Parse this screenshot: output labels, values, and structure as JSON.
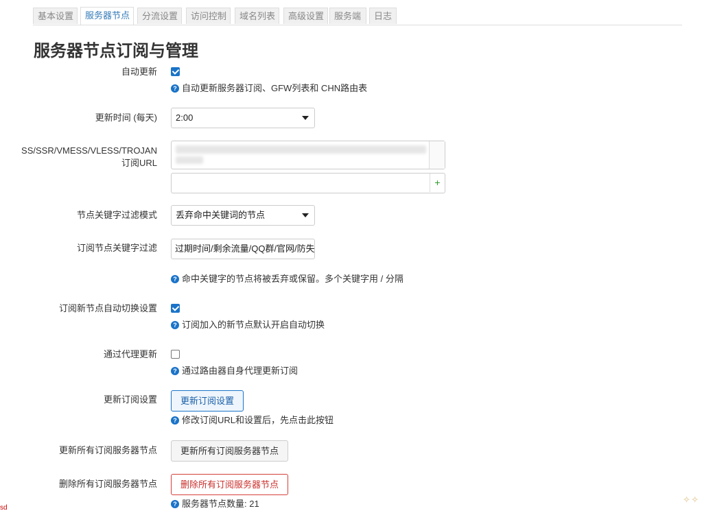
{
  "tabs": [
    {
      "label": "基本设置",
      "active": false
    },
    {
      "label": "服务器节点",
      "active": true
    },
    {
      "label": "分流设置",
      "active": false
    },
    {
      "label": "访问控制",
      "active": false
    },
    {
      "label": "域名列表",
      "active": false
    },
    {
      "label": "高级设置",
      "active": false
    },
    {
      "label": "服务端",
      "active": false
    },
    {
      "label": "日志",
      "active": false
    }
  ],
  "page_title": "服务器节点订阅与管理",
  "form": {
    "auto_update": {
      "label": "自动更新",
      "checked": true,
      "help": "自动更新服务器订阅、GFW列表和 CHN路由表"
    },
    "update_time": {
      "label": "更新时间 (每天)",
      "value": "2:00"
    },
    "subscribe_url": {
      "label_line1": "SS/SSR/VMESS/VLESS/TROJAN",
      "label_line2": "订阅URL",
      "new_value": "",
      "add_symbol": "+"
    },
    "filter_mode": {
      "label": "节点关键字过滤模式",
      "value": "丢弃命中关键词的节点"
    },
    "filter_keywords": {
      "label": "订阅节点关键字过滤",
      "value": "过期时间/剩余流量/QQ群/官网/防失",
      "help": "命中关键字的节点将被丢弃或保留。多个关键字用 / 分隔"
    },
    "auto_switch": {
      "label": "订阅新节点自动切换设置",
      "checked": true,
      "help": "订阅加入的新节点默认开启自动切换"
    },
    "proxy_update": {
      "label": "通过代理更新",
      "checked": false,
      "help": "通过路由器自身代理更新订阅"
    },
    "update_settings": {
      "label": "更新订阅设置",
      "button": "更新订阅设置",
      "help": "修改订阅URL和设置后，先点击此按钮"
    },
    "update_all": {
      "label": "更新所有订阅服务器节点",
      "button": "更新所有订阅服务器节点"
    },
    "delete_all": {
      "label": "删除所有订阅服务器节点",
      "button": "删除所有订阅服务器节点",
      "help": "服务器节点数量: 21"
    }
  },
  "help_icon": "?",
  "corner_text": "sd"
}
